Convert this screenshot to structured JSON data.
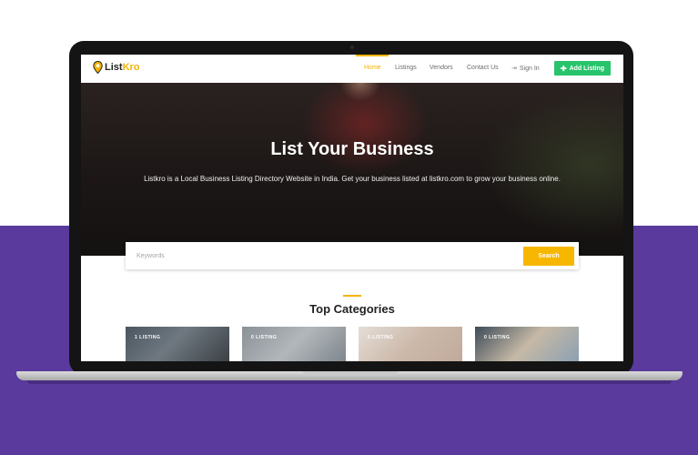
{
  "brand": {
    "logo_part1": "List",
    "logo_part2": "Kro",
    "accent_color": "#f5b400",
    "purple_bg": "#5a3a9c"
  },
  "nav": {
    "links": [
      {
        "label": "Home",
        "active": true
      },
      {
        "label": "Listings",
        "active": false
      },
      {
        "label": "Vendors",
        "active": false
      },
      {
        "label": "Contact Us",
        "active": false
      }
    ],
    "signin_label": "Sign In",
    "add_listing_label": "Add Listing"
  },
  "hero": {
    "title": "List Your Business",
    "subtitle": "Listkro is a Local Business Listing Directory Website in India. Get your business listed at listkro.com to grow your business online."
  },
  "search": {
    "placeholder": "Keywords",
    "button_label": "Search"
  },
  "categories": {
    "title": "Top Categories",
    "cards": [
      {
        "label": "1 LISTING"
      },
      {
        "label": "0 LISTING"
      },
      {
        "label": "0 LISTING"
      },
      {
        "label": "0 LISTING"
      }
    ]
  }
}
